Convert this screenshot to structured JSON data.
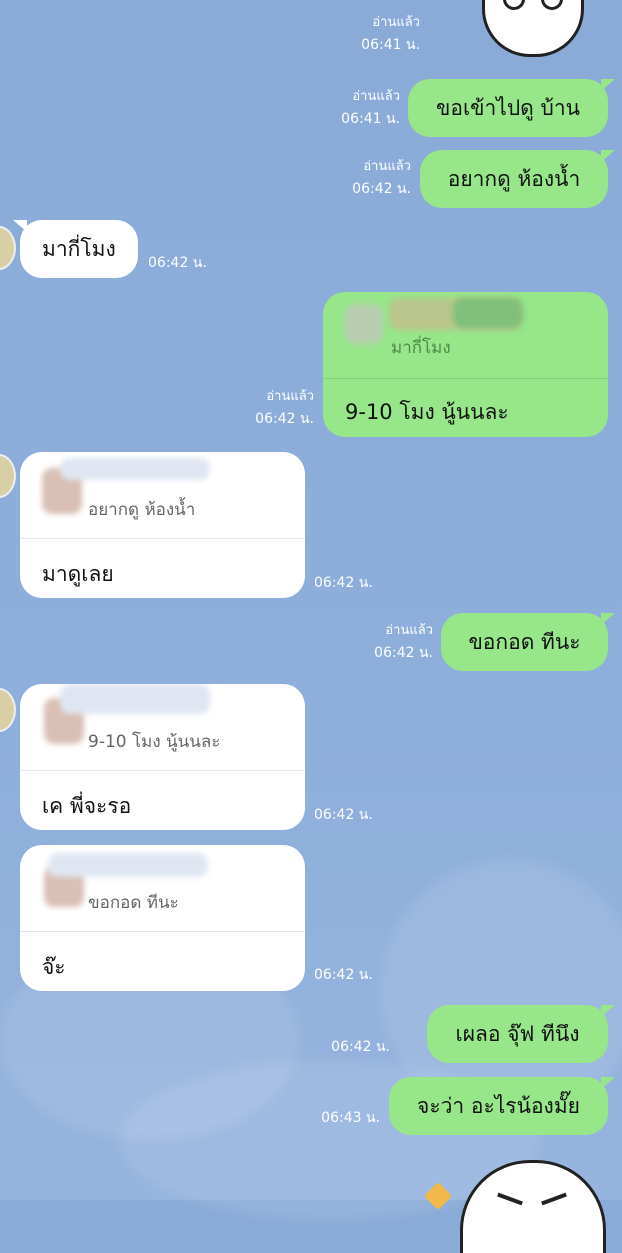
{
  "status": {
    "read": "อ่านแล้ว"
  },
  "messages": {
    "m0": {
      "time": "06:41 น."
    },
    "m1": {
      "text": "ขอเข้าไปดู บ้าน",
      "time": "06:41 น."
    },
    "m2": {
      "text": "อยากดู ห้องน้ำ",
      "time": "06:42 น."
    },
    "m3": {
      "text": "มากี่โมง",
      "time": "06:42 น."
    },
    "m4": {
      "quote": "มากี่โมง",
      "text": "9-10 โมง นู้นนละ",
      "time": "06:42 น."
    },
    "m5": {
      "quote": "อยากดู ห้องน้ำ",
      "text": "มาดูเลย",
      "time": "06:42 น."
    },
    "m6": {
      "text": "ขอกอด ทีนะ",
      "time": "06:42 น."
    },
    "m7": {
      "quote": "9-10 โมง นู้นนละ",
      "text": "เค พี่จะรอ",
      "time": "06:42 น."
    },
    "m8": {
      "quote": "ขอกอด ทีนะ",
      "text": "จ๊ะ",
      "time": "06:42 น."
    },
    "m9": {
      "text": "เผลอ จุ๊ฟ ทีนึง",
      "time": "06:42 น."
    },
    "m10": {
      "text": "จะว่า อะไรน้องมั๊ย",
      "time": "06:43 น."
    }
  },
  "colors": {
    "background": "#8eaedb",
    "outgoing_bubble": "#97e68a",
    "incoming_bubble": "#ffffff",
    "meta_text": "#ffffff"
  },
  "icons": [
    "sticker-face-icon",
    "contact-avatar"
  ]
}
